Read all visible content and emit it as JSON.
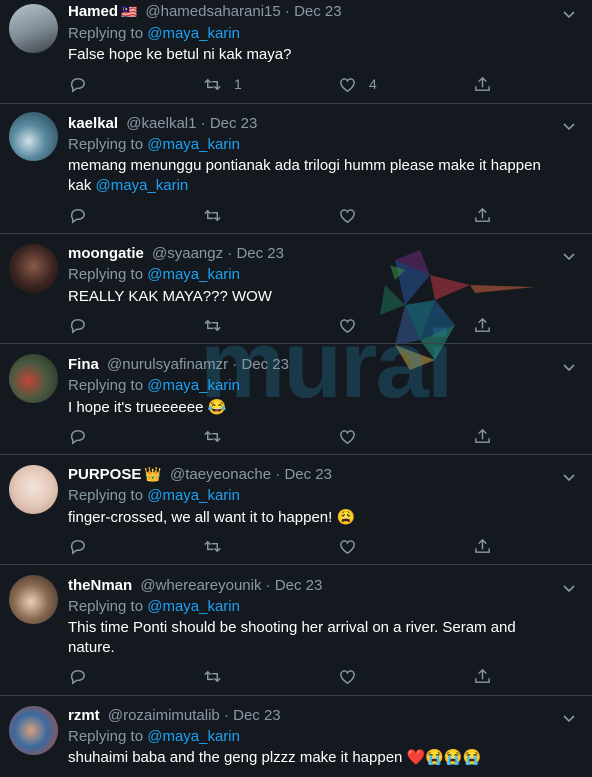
{
  "colors": {
    "background": "#14191f",
    "accent": "#1da1f2",
    "muted": "#8899a6",
    "divider": "#38444d"
  },
  "replying_label": "Replying to",
  "watermark": {
    "text": "murai"
  },
  "tweets": [
    {
      "name": "Hamed",
      "flag": "🇲🇾",
      "handle": "@hamedsaharani15",
      "sep": "·",
      "date": "Dec 23",
      "reply_to": "@maya_karin",
      "text": "False hope ke betul ni kak maya?",
      "retweets": "1",
      "likes": "4"
    },
    {
      "name": "kaelkal",
      "handle": "@kaelkal1",
      "sep": "·",
      "date": "Dec 23",
      "reply_to": "@maya_karin",
      "text": "memang menunggu pontianak ada trilogi humm please make it happen kak",
      "text_mention": "@maya_karin"
    },
    {
      "name": "moongatie",
      "handle": "@syaangz",
      "sep": "·",
      "date": "Dec 23",
      "reply_to": "@maya_karin",
      "text": "REALLY KAK MAYA??? WOW"
    },
    {
      "name": "Fina",
      "handle": "@nurulsyafinamzr",
      "sep": "·",
      "date": "Dec 23",
      "reply_to": "@maya_karin",
      "text": "I hope it's trueeeeee",
      "emoji": "😂"
    },
    {
      "name": "PURPOSE",
      "crown": "👑",
      "handle": "@taeyeonache",
      "sep": "·",
      "date": "Dec 23",
      "reply_to": "@maya_karin",
      "text": "finger-crossed, we all want it to happen!",
      "emoji": "😩"
    },
    {
      "name": "theNman",
      "handle": "@whereareyounik",
      "sep": "·",
      "date": "Dec 23",
      "reply_to": "@maya_karin",
      "text": "This time Ponti should be shooting her arrival on a river. Seram and nature."
    },
    {
      "name": "rzmt",
      "handle": "@rozaimimutalib",
      "sep": "·",
      "date": "Dec 23",
      "reply_to": "@maya_karin",
      "text": "shuhaimi baba and the geng plzzz make it happen",
      "emoji": "❤️😭😭😭"
    }
  ]
}
